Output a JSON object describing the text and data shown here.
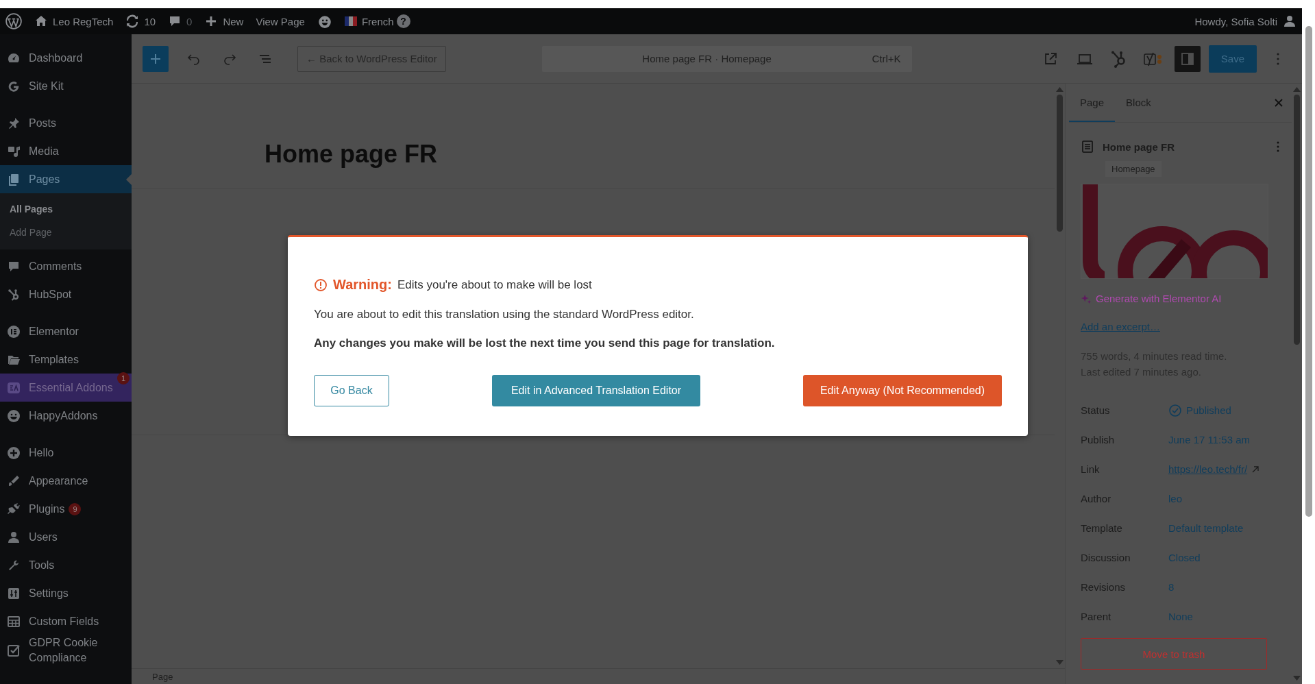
{
  "admin_bar": {
    "items": [
      {
        "kind": "site",
        "label": "Leo RegTech"
      },
      {
        "kind": "updates",
        "label": "10"
      },
      {
        "kind": "comments",
        "label": "0"
      },
      {
        "kind": "new",
        "label": "New"
      },
      {
        "kind": "link",
        "label": "View Page"
      },
      {
        "kind": "happy"
      },
      {
        "kind": "language",
        "label": "French"
      },
      {
        "kind": "help",
        "label": "?"
      }
    ],
    "user": "Howdy, Sofia Solti"
  },
  "sidebar": {
    "groups": [
      {
        "items": [
          {
            "label": "Dashboard",
            "selected": false,
            "highlighted": false
          },
          {
            "label": "Site Kit",
            "selected": false,
            "highlighted": false
          }
        ]
      },
      {
        "items": [
          {
            "label": "Posts",
            "selected": false,
            "highlighted": false
          },
          {
            "label": "Media",
            "selected": false,
            "highlighted": false
          },
          {
            "label": "Pages",
            "selected": true,
            "highlighted": false,
            "children": [
              {
                "label": "All Pages",
                "selected": true
              },
              {
                "label": "Add Page",
                "selected": false
              }
            ]
          },
          {
            "label": "Comments",
            "selected": false,
            "highlighted": false
          },
          {
            "label": "HubSpot",
            "selected": false,
            "highlighted": false
          }
        ]
      },
      {
        "items": [
          {
            "label": "Elementor",
            "selected": false,
            "highlighted": false
          },
          {
            "label": "Templates",
            "selected": false,
            "highlighted": false
          },
          {
            "label": "Essential Addons",
            "selected": false,
            "highlighted": true,
            "badge": "1"
          },
          {
            "label": "HappyAddons",
            "selected": false,
            "highlighted": false
          }
        ]
      },
      {
        "items": [
          {
            "label": "Hello",
            "selected": false,
            "highlighted": false
          },
          {
            "label": "Appearance",
            "selected": false,
            "highlighted": false
          },
          {
            "label": "Plugins",
            "selected": false,
            "highlighted": false,
            "badge": "9"
          },
          {
            "label": "Users",
            "selected": false,
            "highlighted": false
          },
          {
            "label": "Tools",
            "selected": false,
            "highlighted": false
          },
          {
            "label": "Settings",
            "selected": false,
            "highlighted": false
          },
          {
            "label": "Custom Fields",
            "selected": false,
            "highlighted": false
          },
          {
            "label": "GDPR Cookie Compliance",
            "selected": false,
            "highlighted": false
          }
        ]
      }
    ]
  },
  "editor_toolbar": {
    "back_button": "← Back to WordPress Editor",
    "command_bar": {
      "title": "Home page FR · Homepage",
      "shortcut": "Ctrl+K"
    },
    "save_button": "Save"
  },
  "editor": {
    "title": "Home page FR",
    "status_bar": "Page"
  },
  "settings_panel": {
    "tabs": [
      {
        "label": "Page",
        "selected": true
      },
      {
        "label": "Block",
        "selected": false
      }
    ],
    "page_title": "Home page FR",
    "template_badge": "Homepage",
    "featured_image": {
      "kind": "picture"
    },
    "ai_link": "Generate with Elementor AI",
    "excerpt_link": "Add an excerpt…",
    "stats": [
      "755 words, 4 minutes read time.",
      "Last edited 7 minutes ago."
    ],
    "rows": [
      {
        "kind": "status",
        "label": "Status",
        "value": "Published"
      },
      {
        "kind": "text",
        "label": "Publish",
        "value": "June 17 11:53 am"
      },
      {
        "kind": "link",
        "label": "Link",
        "value": "https://leo.tech/fr/"
      },
      {
        "kind": "text",
        "label": "Author",
        "value": "leo"
      },
      {
        "kind": "text",
        "label": "Template",
        "value": "Default template"
      },
      {
        "kind": "text",
        "label": "Discussion",
        "value": "Closed"
      },
      {
        "kind": "text",
        "label": "Revisions",
        "value": "8"
      },
      {
        "kind": "text",
        "label": "Parent",
        "value": "None"
      }
    ],
    "trash_button": "Move to trash"
  },
  "modal": {
    "warning": {
      "label": "Warning:",
      "message": "Edits you're about to make will be lost"
    },
    "paragraphs": [
      {
        "text": "You are about to edit this translation using the standard WordPress editor.",
        "bold": false
      },
      {
        "text": "Any changes you make will be lost the next time you send this page for translation.",
        "bold": true
      }
    ],
    "buttons": [
      {
        "kind": "outline",
        "label": "Go Back"
      },
      {
        "kind": "primary",
        "label": "Edit in Advanced Translation Editor"
      },
      {
        "kind": "danger",
        "label": "Edit Anyway (Not Recommended)"
      }
    ]
  }
}
